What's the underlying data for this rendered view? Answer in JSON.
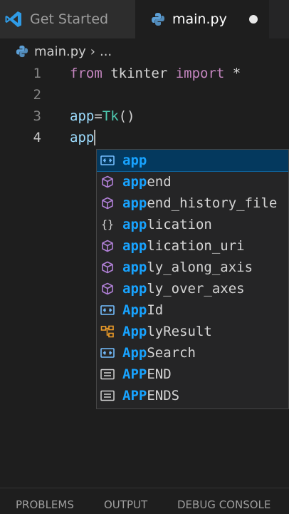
{
  "tabs": [
    {
      "label": "Get Started"
    },
    {
      "label": "main.py"
    }
  ],
  "breadcrumb": {
    "file": "main.py",
    "separator": "›",
    "more": "..."
  },
  "editor": {
    "lines": [
      {
        "number": "1",
        "tokens": [
          "from",
          " tkinter ",
          "import",
          " *"
        ]
      },
      {
        "number": "2",
        "tokens": []
      },
      {
        "number": "3",
        "tokens": [
          "app",
          "=",
          "Tk",
          "()"
        ]
      },
      {
        "number": "4",
        "tokens": [
          "app"
        ]
      }
    ]
  },
  "suggestions": [
    {
      "match": "app",
      "rest": "",
      "kind": "variable",
      "selected": true
    },
    {
      "match": "app",
      "rest": "end",
      "kind": "method"
    },
    {
      "match": "app",
      "rest": "end_history_file",
      "kind": "method"
    },
    {
      "match": "app",
      "rest": "lication",
      "kind": "module"
    },
    {
      "match": "app",
      "rest": "lication_uri",
      "kind": "method"
    },
    {
      "match": "app",
      "rest": "ly_along_axis",
      "kind": "method"
    },
    {
      "match": "app",
      "rest": "ly_over_axes",
      "kind": "method"
    },
    {
      "match": "App",
      "rest": "Id",
      "kind": "variable"
    },
    {
      "match": "App",
      "rest": "lyResult",
      "kind": "class"
    },
    {
      "match": "App",
      "rest": "Search",
      "kind": "variable"
    },
    {
      "match": "APP",
      "rest": "END",
      "kind": "constant"
    },
    {
      "match": "APP",
      "rest": "ENDS",
      "kind": "constant"
    }
  ],
  "panel": {
    "tabs": [
      "PROBLEMS",
      "OUTPUT",
      "DEBUG CONSOLE"
    ]
  },
  "colors": {
    "accent": "#0e639c",
    "match": "#18a3ff",
    "keyword": "#c586c0",
    "type": "#4ec9b0",
    "variable": "#9cdcfe"
  }
}
